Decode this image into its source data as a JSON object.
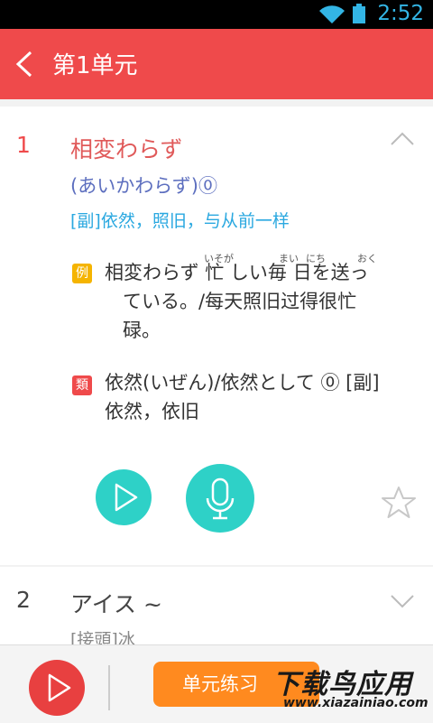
{
  "status_bar": {
    "time": "2:52"
  },
  "app_bar": {
    "title": "第1单元"
  },
  "entries": [
    {
      "number": "1",
      "word": "相変わらず",
      "reading": "(あいかわらず)⓪",
      "meaning": "[副]依然，照旧，与从前一样",
      "example_tag": "例",
      "example_line1": "相変わらず 忙 しい毎 日を送っ",
      "example_line2": "ている。/每天照旧过得很忙",
      "example_line3": "碌。",
      "ruby": [
        "いそが",
        "まい",
        "にち",
        "おく"
      ],
      "synonym_tag": "類",
      "synonym_line1": "依然(いぜん)/依然として ⓪ [副]",
      "synonym_line2": "依然，依旧"
    },
    {
      "number": "2",
      "word": "アイス ~",
      "meaning": "[接頭]冰"
    }
  ],
  "bottom_bar": {
    "practice_label": "单元练习",
    "watermark_cn": "下载鸟应用",
    "watermark_url": "www.xiazainiao.com"
  },
  "colors": {
    "accent": "#ef4a4b",
    "teal": "#2ed1c7",
    "orange": "#ff8a1f"
  }
}
